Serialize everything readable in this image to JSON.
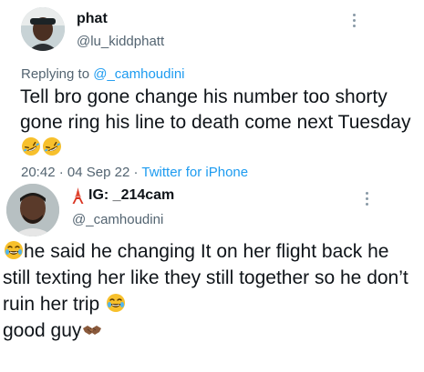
{
  "tweet1": {
    "display_name": "phat",
    "handle": "@lu_kiddphatt",
    "replying_to_prefix": "Replying to",
    "replying_to_mention": "@_camhoudini",
    "text": "Tell bro gone change his number too shorty gone ring his line  to death come next Tuesday",
    "emojis": [
      "rolling-on-floor-laughing-emoji",
      "rolling-on-floor-laughing-emoji"
    ],
    "time": "20:42",
    "date": "04 Sep 22",
    "separator": "·",
    "source": "Twitter for iPhone"
  },
  "tweet2": {
    "display_name_prefix_icon": "tokyo-tower-emoji",
    "display_name": "IG: _214cam",
    "handle": "@_camhoudini",
    "leading_emoji": "tears-of-joy-emoji",
    "text_part1": "he said he changing It on her flight back he still texting her like they still together so he don’t ruin her trip",
    "middle_emoji": "tears-of-joy-emoji",
    "text_part2": "good guy",
    "trailing_emoji": "handshake-emoji"
  },
  "icons": {
    "more": "more-options-icon"
  },
  "colors": {
    "text_primary": "#0f1419",
    "text_secondary": "#536471",
    "link": "#1d9bf0"
  }
}
